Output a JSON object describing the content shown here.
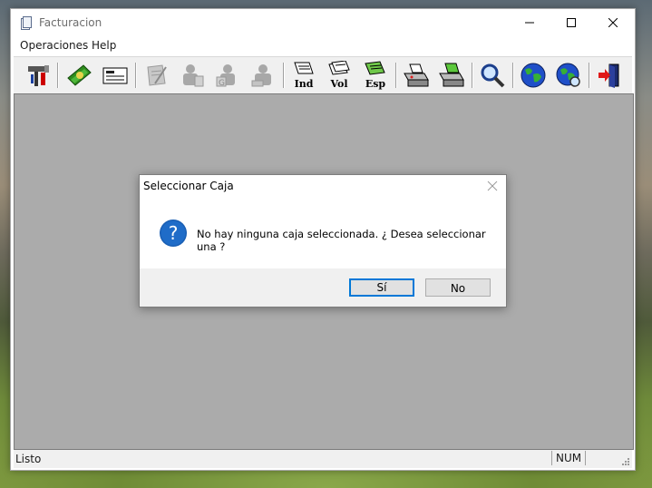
{
  "window": {
    "title": "Facturacion"
  },
  "menu": {
    "items": [
      "Operaciones",
      "Help"
    ]
  },
  "toolbar": {
    "buttons": [
      {
        "icon": "tools-icon",
        "label": ""
      },
      {
        "icon": "money-icon",
        "label": ""
      },
      {
        "icon": "form-icon",
        "label": ""
      },
      {
        "icon": "pen-paper-icon",
        "label": ""
      },
      {
        "icon": "person-pen-icon",
        "label": ""
      },
      {
        "icon": "person-g-icon",
        "label": ""
      },
      {
        "icon": "person-stamp-icon",
        "label": ""
      },
      {
        "icon": "document-ind-icon",
        "label": "Ind"
      },
      {
        "icon": "document-vol-icon",
        "label": "Vol"
      },
      {
        "icon": "document-esp-icon",
        "label": "Esp"
      },
      {
        "icon": "printer-icon",
        "label": ""
      },
      {
        "icon": "printer-green-icon",
        "label": ""
      },
      {
        "icon": "magnifier-icon",
        "label": ""
      },
      {
        "icon": "globe-icon",
        "label": ""
      },
      {
        "icon": "globe-search-icon",
        "label": ""
      },
      {
        "icon": "exit-door-icon",
        "label": ""
      }
    ]
  },
  "status": {
    "text": "Listo",
    "num": "NUM"
  },
  "dialog": {
    "title": "Seleccionar Caja",
    "message": "No hay ninguna caja seleccionada. ¿ Desea seleccionar una ?",
    "yes_label": "Sí",
    "no_label": "No"
  },
  "colors": {
    "client_bg": "#ababab",
    "accent": "#0078d7",
    "question_icon": "#1a5fb4"
  }
}
